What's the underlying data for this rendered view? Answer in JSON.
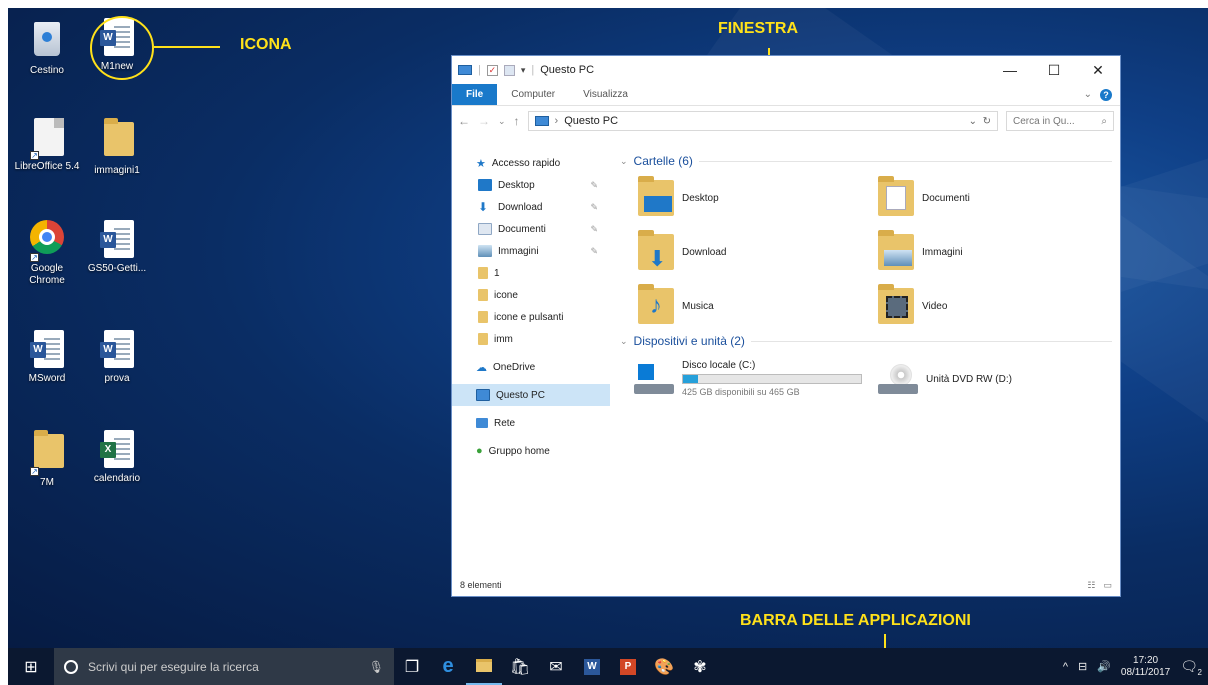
{
  "annotations": {
    "icon": "ICONA",
    "window": "FINESTRA",
    "taskbar": "BARRA DELLE APPLICAZIONI"
  },
  "desktop_icons": [
    {
      "label": "Cestino",
      "icon": "recycle-bin-icon"
    },
    {
      "label": "M1new",
      "icon": "word-document-icon"
    },
    {
      "label": "LibreOffice 5.4",
      "icon": "libreoffice-icon"
    },
    {
      "label": "immagini1",
      "icon": "folder-icon"
    },
    {
      "label": "Google Chrome",
      "icon": "chrome-icon"
    },
    {
      "label": "GS50-Getti...",
      "icon": "word-document-icon"
    },
    {
      "label": "MSword",
      "icon": "word-document-icon"
    },
    {
      "label": "prova",
      "icon": "word-document-icon"
    },
    {
      "label": "7M",
      "icon": "folder-icon"
    },
    {
      "label": "calendario",
      "icon": "excel-document-icon"
    }
  ],
  "window": {
    "title": "Questo PC",
    "controls": {
      "minimize": "—",
      "maximize": "☐",
      "close": "✕"
    },
    "ribbon_tabs": [
      "File",
      "Computer",
      "Visualizza"
    ],
    "address": {
      "path_root": "Questo PC",
      "search_placeholder": "Cerca in Qu..."
    },
    "nav": {
      "quick_access": "Accesso rapido",
      "quick_items": [
        {
          "label": "Desktop",
          "pinned": true,
          "color": "#1f78c8"
        },
        {
          "label": "Download",
          "pinned": true,
          "color": "#1f78c8"
        },
        {
          "label": "Documenti",
          "pinned": true,
          "color": "#8fa7c4"
        },
        {
          "label": "Immagini",
          "pinned": true,
          "color": "#5f8fb8"
        },
        {
          "label": "1",
          "pinned": false,
          "color": "#e9c46a"
        },
        {
          "label": "icone",
          "pinned": false,
          "color": "#e9c46a"
        },
        {
          "label": "icone e pulsanti",
          "pinned": false,
          "color": "#e9c46a"
        },
        {
          "label": "imm",
          "pinned": false,
          "color": "#e9c46a"
        }
      ],
      "onedrive": "OneDrive",
      "this_pc": "Questo PC",
      "network": "Rete",
      "homegroup": "Gruppo home"
    },
    "folders_group": "Cartelle (6)",
    "folders": [
      "Desktop",
      "Documenti",
      "Download",
      "Immagini",
      "Musica",
      "Video"
    ],
    "devices_group": "Dispositivi e unità (2)",
    "drives": [
      {
        "name": "Disco locale (C:)",
        "free": "425 GB disponibili su 465 GB",
        "used_fraction": 0.086
      },
      {
        "name": "Unità DVD RW (D:)"
      }
    ],
    "status": "8 elementi"
  },
  "taskbar": {
    "search_placeholder": "Scrivi qui per eseguire la ricerca",
    "time": "17:20",
    "date": "08/11/2017",
    "notifications": "2"
  }
}
